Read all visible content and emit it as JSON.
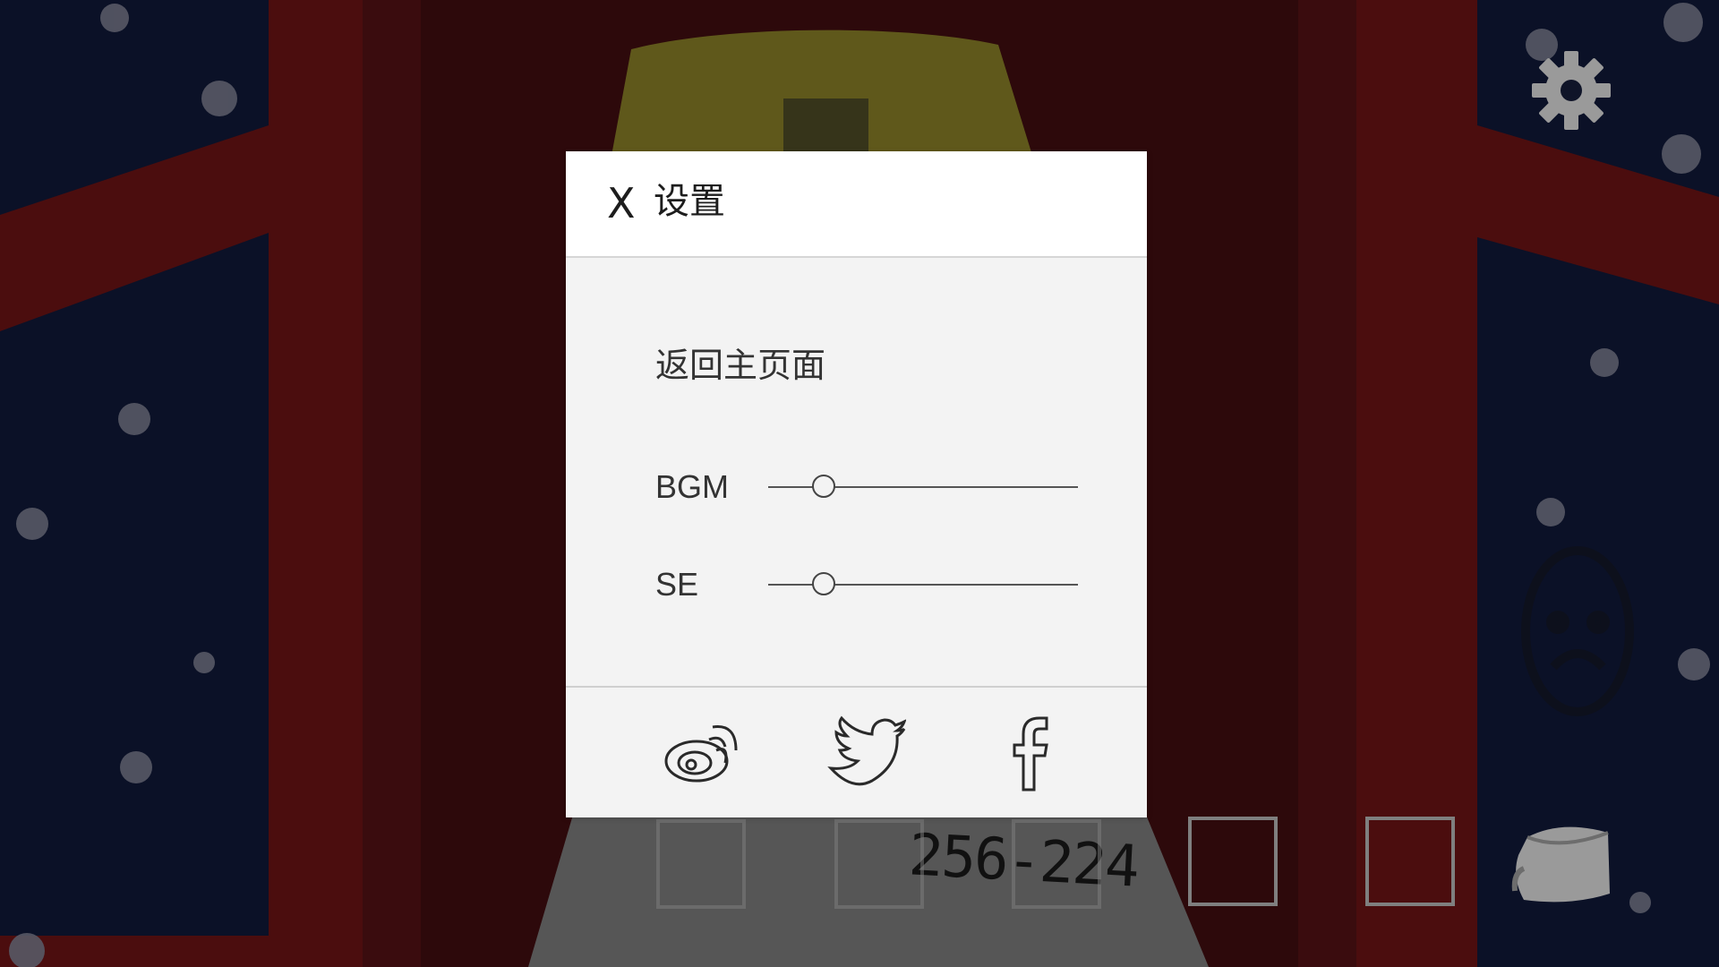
{
  "dialog": {
    "close_label": "X",
    "title": "设置",
    "menu": {
      "return_home": "返回主页面"
    },
    "sliders": [
      {
        "label": "BGM",
        "value": 0.18
      },
      {
        "label": "SE",
        "value": 0.18
      }
    ],
    "social": {
      "weibo": "weibo-icon",
      "twitter": "twitter-icon",
      "facebook": "facebook-icon"
    }
  },
  "hud": {
    "code_note": "256-224",
    "settings_icon": "gear-icon",
    "inventory_icon": "bag-icon",
    "inventory_slots": 5
  },
  "colors": {
    "wall_red": "#7a1518",
    "wall_dark": "#3e0d10",
    "window_blue": "#131c3f",
    "panel_bg": "#f3f3f3",
    "header_bg": "#ffffff"
  }
}
